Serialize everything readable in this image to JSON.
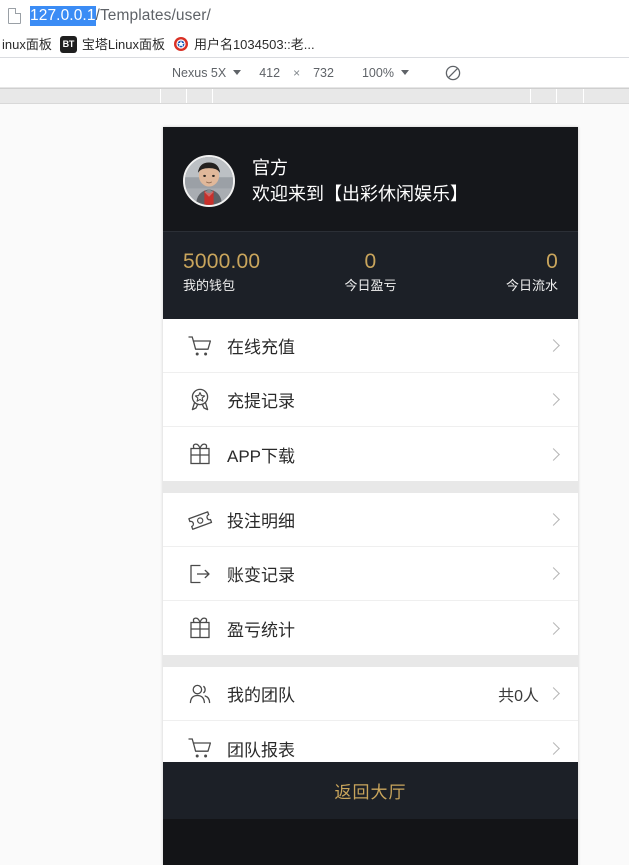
{
  "browser": {
    "url": {
      "host": "127.0.0.1",
      "path": "/Templates/user/"
    },
    "page_icon": "document-icon",
    "bookmarks": [
      {
        "label": "inux面板",
        "icon": "generic-site-icon"
      },
      {
        "label": "宝塔Linux面板",
        "icon": "bt-panel-icon",
        "badge": "BT"
      },
      {
        "label": "用户名1034503::老...",
        "icon": "user-site-icon"
      }
    ]
  },
  "device_toolbar": {
    "device": "Nexus 5X",
    "width": "412",
    "separator": "×",
    "height": "732",
    "zoom": "100%",
    "rotate_icon": "rotate-icon",
    "device_caret": "chevron-down-icon",
    "zoom_caret": "chevron-down-icon"
  },
  "app": {
    "profile": {
      "avatar": "user-photo-avatar",
      "name": "官方",
      "welcome": "欢迎来到【出彩休闲娱乐】"
    },
    "stats": [
      {
        "value": "5000.00",
        "label": "我的钱包"
      },
      {
        "value": "0",
        "label": "今日盈亏"
      },
      {
        "value": "0",
        "label": "今日流水"
      }
    ],
    "menu_groups": [
      {
        "items": [
          {
            "icon": "shopping-cart-icon",
            "label": "在线充值",
            "extra": ""
          },
          {
            "icon": "medal-star-icon",
            "label": "充提记录",
            "extra": ""
          },
          {
            "icon": "gift-box-icon",
            "label": "APP下载",
            "extra": ""
          }
        ]
      },
      {
        "items": [
          {
            "icon": "ticket-icon",
            "label": "投注明细",
            "extra": ""
          },
          {
            "icon": "logout-arrow-icon",
            "label": "账变记录",
            "extra": ""
          },
          {
            "icon": "gift-box-icon",
            "label": "盈亏统计",
            "extra": ""
          }
        ]
      },
      {
        "items": [
          {
            "icon": "people-icon",
            "label": "我的团队",
            "extra": "共0人"
          },
          {
            "icon": "shopping-cart-icon",
            "label": "团队报表",
            "extra": ""
          }
        ]
      }
    ],
    "bottom_bar": {
      "label": "返回大厅"
    }
  },
  "colors": {
    "header_dark": "#15171b",
    "stats_dark": "#1c2027",
    "gold": "#c9a55c",
    "selection_blue": "#3b8cf5",
    "group_gap": "#e8e8e8"
  }
}
